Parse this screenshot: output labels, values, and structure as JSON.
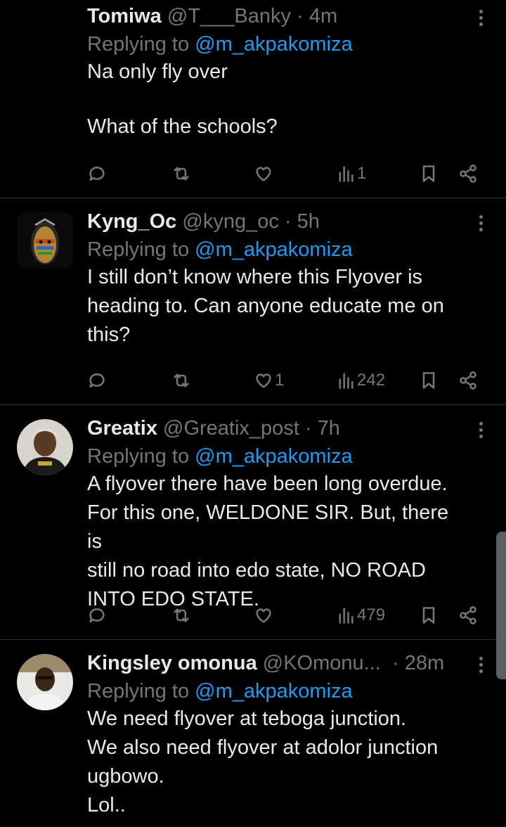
{
  "colors": {
    "background": "#000000",
    "text": "#e7e9ea",
    "muted": "#71767b",
    "mention": "#1d9bf0",
    "divider": "#2f3336"
  },
  "tweets": [
    {
      "name": "Tomiwa",
      "handle": "@T___Banky",
      "sep": "·",
      "time": "4m",
      "replying_prefix": "Replying to",
      "replying_to": "@m_akpakomiza",
      "lines": [
        "Na only fly over",
        "",
        "What of the schools?"
      ],
      "reply_count": "",
      "retweet_count": "",
      "like_count": "",
      "view_count": "1"
    },
    {
      "name": "Kyng_Oc",
      "handle": "@kyng_oc",
      "sep": "·",
      "time": "5h",
      "replying_prefix": "Replying to",
      "replying_to": "@m_akpakomiza",
      "lines": [
        "I still don’t know where this Flyover is",
        "heading to. Can anyone educate me on",
        "this?"
      ],
      "reply_count": "",
      "retweet_count": "",
      "like_count": "1",
      "view_count": "242"
    },
    {
      "name": "Greatix",
      "handle": "@Greatix_post",
      "sep": "·",
      "time": "7h",
      "replying_prefix": "Replying to",
      "replying_to": "@m_akpakomiza",
      "lines": [
        "A flyover there have been long overdue.",
        "For this one, WELDONE SIR. But, there is",
        "still no road into edo state, NO ROAD",
        "INTO EDO STATE."
      ],
      "reply_count": "",
      "retweet_count": "",
      "like_count": "",
      "view_count": "479"
    },
    {
      "name": "Kingsley omonua",
      "handle": "@KOmonu...",
      "sep": "·",
      "time": "28m",
      "replying_prefix": "Replying to",
      "replying_to": "@m_akpakomiza",
      "lines": [
        "We need flyover at teboga junction.",
        "We also need flyover at adolor junction",
        "ugbowo.",
        "Lol.."
      ]
    }
  ]
}
